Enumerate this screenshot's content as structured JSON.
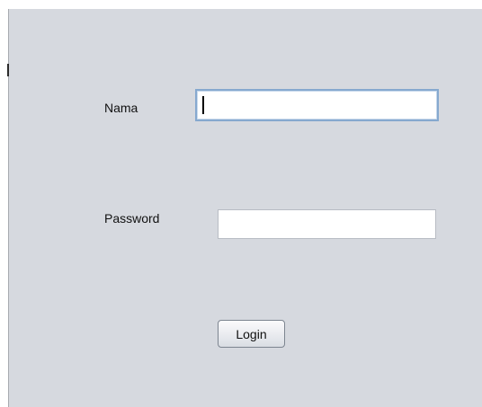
{
  "form": {
    "nama_label": "Nama",
    "nama_value": "",
    "password_label": "Password",
    "password_value": "",
    "login_label": "Login"
  }
}
